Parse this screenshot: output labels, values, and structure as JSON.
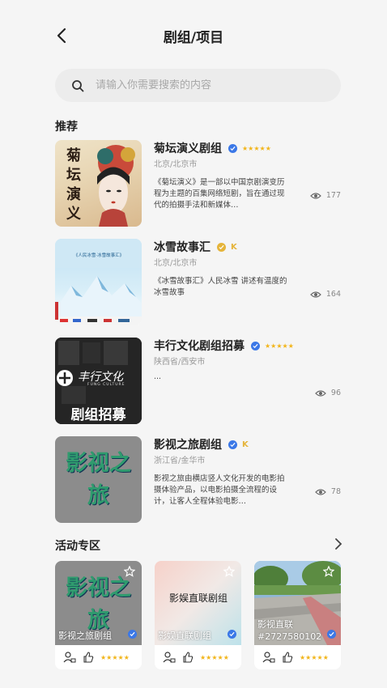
{
  "header": {
    "title": "剧组/项目"
  },
  "search": {
    "placeholder": "请输入你需要搜索的内容"
  },
  "recommend": {
    "title": "推荐",
    "items": [
      {
        "name": "菊坛演义剧组",
        "location": "北京/北京市",
        "desc": "《菊坛演义》是一部以中国京剧演变历程为主题的百集网络短剧，旨在通过现代的拍摄手法和新媒体…",
        "views": "177",
        "thumb_text": "菊坛演义"
      },
      {
        "name": "冰雪故事汇",
        "location": "北京/北京市",
        "desc": "《冰雪故事汇》人民冰雪 讲述有温度的冰雪故事",
        "views": "164",
        "thumb_text": "《人民冰雪·冰雪故事汇》"
      },
      {
        "name": "丰行文化剧组招募",
        "location": "陕西省/西安市",
        "desc": "...",
        "views": "96",
        "thumb_text": "丰行文化",
        "thumb_sub": "FUNG CULTURE",
        "thumb_banner": "剧组招募"
      },
      {
        "name": "影视之旅剧组",
        "location": "浙江省/金华市",
        "desc": "影视之旅由横店竖人文化开发的电影拍摄体验产品，以电影拍摄全流程的设计，让客人全程体验电影…",
        "views": "78",
        "thumb_text": "影视之旅"
      }
    ]
  },
  "activity": {
    "title": "活动专区",
    "cards": [
      {
        "label": "影视之旅剧组",
        "img_text": "影视之旅"
      },
      {
        "label": "影娱直联剧组",
        "img_text": "影娱直联剧组"
      },
      {
        "label": "影视直联#2727580102",
        "label_line1": "影视直联",
        "label_line2": "#2727580102"
      }
    ]
  },
  "colors": {
    "verify_blue": "#3b78e7",
    "star_gold": "#f2b51a",
    "bg": "#f5f5f5"
  },
  "stars": "★★★★★",
  "k_mark": "K"
}
